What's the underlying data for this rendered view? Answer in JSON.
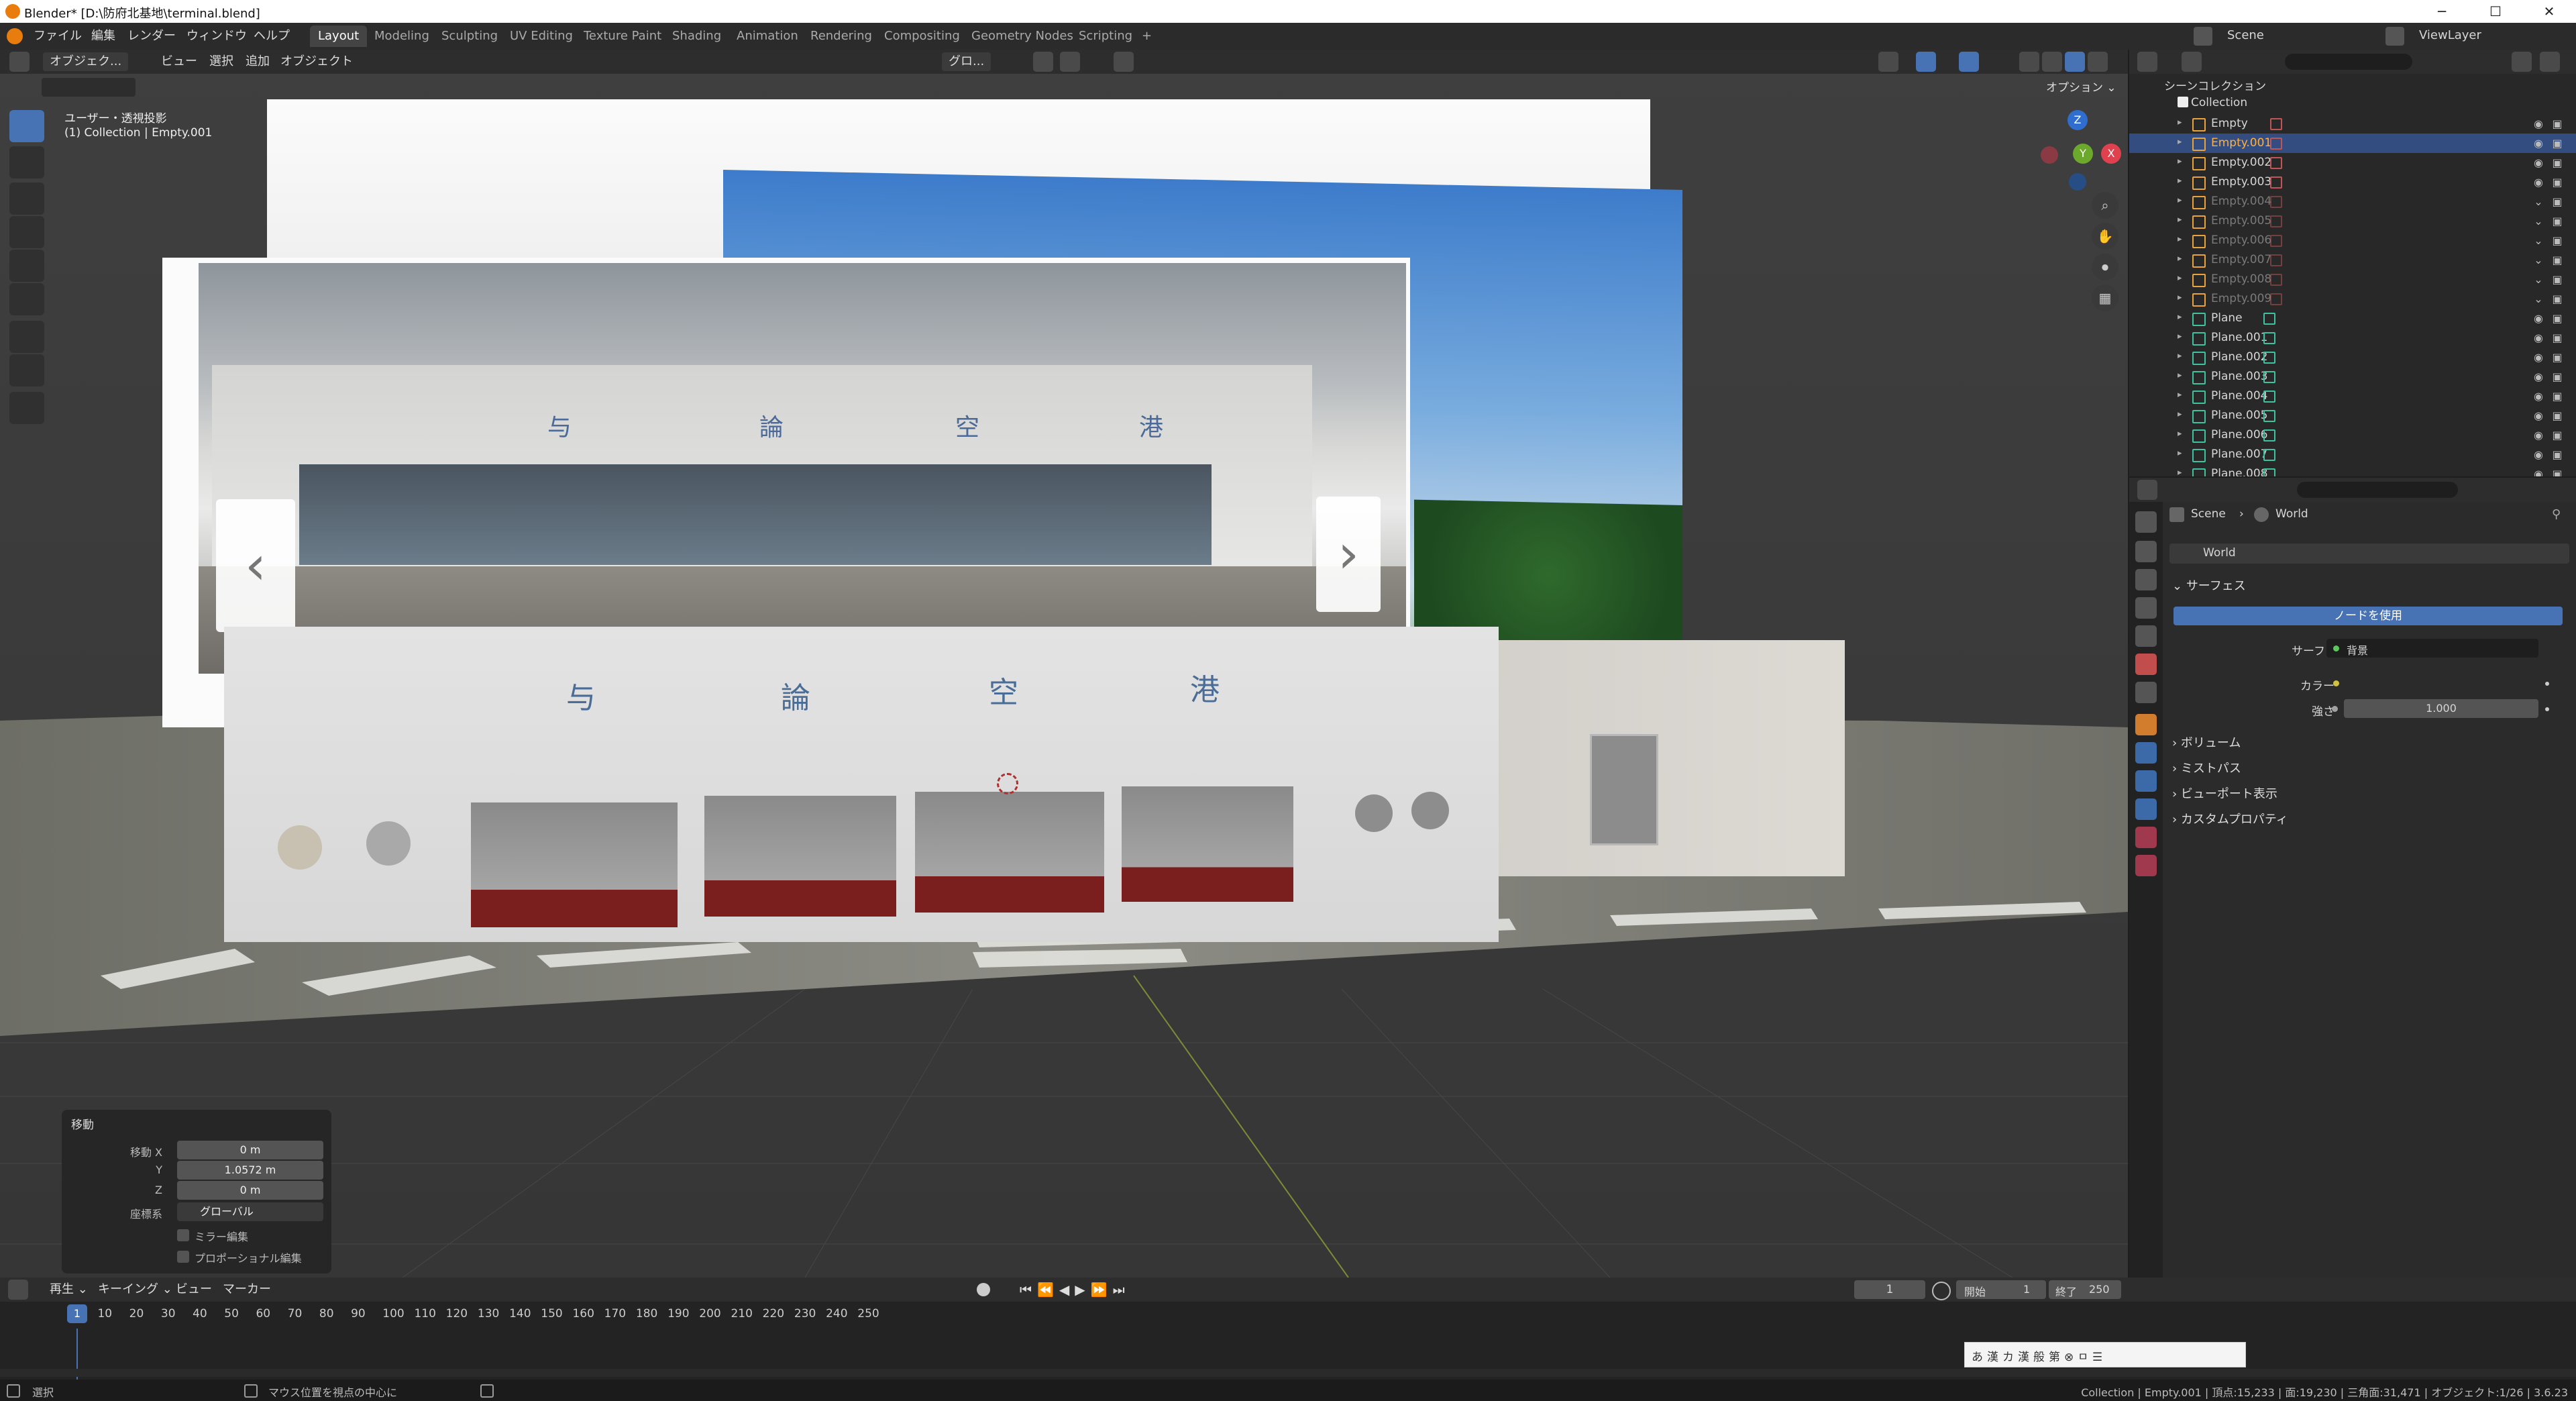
{
  "titlebar": {
    "title": "Blender* [D:\\防府北基地\\terminal.blend]",
    "minimize": "─",
    "maximize": "☐",
    "close": "✕"
  },
  "menubar": {
    "menus": [
      "ファイル",
      "編集",
      "レンダー",
      "ウィンドウ",
      "ヘルプ"
    ],
    "workspaces": [
      "Layout",
      "Modeling",
      "Sculpting",
      "UV Editing",
      "Texture Paint",
      "Shading",
      "Animation",
      "Rendering",
      "Compositing",
      "Geometry Nodes",
      "Scripting"
    ],
    "active_workspace": "Layout",
    "add_tab": "+",
    "scene": "Scene",
    "view_layer": "ViewLayer"
  },
  "viewport": {
    "mode": "オブジェク...",
    "menus": [
      "ビュー",
      "選択",
      "追加",
      "オブジェクト"
    ],
    "transform_orientation": "グロ...",
    "options": "オプション ⌄",
    "overlay_line1": "ユーザー・透視投影",
    "overlay_line2": "(1) Collection | Empty.001",
    "gizmo": {
      "z": "Z",
      "y": "Y",
      "x": "X"
    },
    "sign_chars": [
      "与",
      "論",
      "空",
      "港"
    ],
    "photo_left_arrow": "‹",
    "photo_right_arrow": "›"
  },
  "operator_panel": {
    "title": "移動",
    "rows": [
      {
        "label": "移動 X",
        "value": "0 m"
      },
      {
        "label": "Y",
        "value": "1.0572 m"
      },
      {
        "label": "Z",
        "value": "0 m"
      }
    ],
    "orientation_label": "座標系",
    "orientation_value": "グローバル",
    "mirror_label": "ミラー編集",
    "proportional_label": "プロポーショナル編集"
  },
  "outliner": {
    "scene_collection": "シーンコレクション",
    "collection": "Collection",
    "items": [
      {
        "name": "Empty",
        "type": "empty",
        "selected": false,
        "dim": false
      },
      {
        "name": "Empty.001",
        "type": "empty",
        "selected": true,
        "dim": false
      },
      {
        "name": "Empty.002",
        "type": "empty",
        "selected": false,
        "dim": false
      },
      {
        "name": "Empty.003",
        "type": "empty",
        "selected": false,
        "dim": false
      },
      {
        "name": "Empty.004",
        "type": "empty",
        "selected": false,
        "dim": true
      },
      {
        "name": "Empty.005",
        "type": "empty",
        "selected": false,
        "dim": true
      },
      {
        "name": "Empty.006",
        "type": "empty",
        "selected": false,
        "dim": true
      },
      {
        "name": "Empty.007",
        "type": "empty",
        "selected": false,
        "dim": true
      },
      {
        "name": "Empty.008",
        "type": "empty",
        "selected": false,
        "dim": true
      },
      {
        "name": "Empty.009",
        "type": "empty",
        "selected": false,
        "dim": true
      },
      {
        "name": "Plane",
        "type": "mesh",
        "selected": false,
        "dim": false
      },
      {
        "name": "Plane.001",
        "type": "mesh",
        "selected": false,
        "dim": false
      },
      {
        "name": "Plane.002",
        "type": "mesh",
        "selected": false,
        "dim": false
      },
      {
        "name": "Plane.003",
        "type": "mesh",
        "selected": false,
        "dim": false
      },
      {
        "name": "Plane.004",
        "type": "mesh",
        "selected": false,
        "dim": false
      },
      {
        "name": "Plane.005",
        "type": "mesh",
        "selected": false,
        "dim": false
      },
      {
        "name": "Plane.006",
        "type": "mesh",
        "selected": false,
        "dim": false
      },
      {
        "name": "Plane.007",
        "type": "mesh",
        "selected": false,
        "dim": false
      },
      {
        "name": "Plane.008",
        "type": "mesh",
        "selected": false,
        "dim": false
      }
    ]
  },
  "properties": {
    "breadcrumb_scene": "Scene",
    "breadcrumb_sep": "›",
    "breadcrumb_world": "World",
    "world_name": "World",
    "surface_header": "サーフェス",
    "use_nodes": "ノードを使用",
    "surface_label": "サーフェス",
    "surface_value": "背景",
    "color_label": "カラー",
    "strength_label": "強さ",
    "strength_value": "1.000",
    "collapsed_sections": [
      "ボリューム",
      "ミストパス",
      "ビューポート表示",
      "カスタムプロパティ"
    ]
  },
  "timeline": {
    "menus": [
      "再生 ⌄",
      "キーイング ⌄",
      "ビュー",
      "マーカー"
    ],
    "current_frame": "1",
    "start_label": "開始",
    "start_value": "1",
    "end_label": "終了",
    "end_value": "250",
    "playhead": "1",
    "ticks": [
      "10",
      "20",
      "30",
      "40",
      "50",
      "60",
      "70",
      "80",
      "90",
      "100",
      "110",
      "120",
      "130",
      "140",
      "150",
      "160",
      "170",
      "180",
      "190",
      "200",
      "210",
      "220",
      "230",
      "240",
      "250"
    ]
  },
  "ime": {
    "chars": [
      "あ",
      "漢",
      "カ",
      "漢",
      "般",
      "第",
      "⊗",
      "ㅁ",
      "☰"
    ]
  },
  "statusbar": {
    "select": "選択",
    "hint": "マウス位置を視点の中心に",
    "stats": "Collection | Empty.001 | 頂点:15,233 | 面:19,230 | 三角面:31,471 | オブジェクト:1/26 | 3.6.23"
  },
  "colors": {
    "accent_blue": "#4772b3",
    "selection_row": "#334d80",
    "blender_orange": "#e87d0d",
    "empty_icon": "#e8a33d",
    "mesh_icon": "#3ec2a0"
  }
}
